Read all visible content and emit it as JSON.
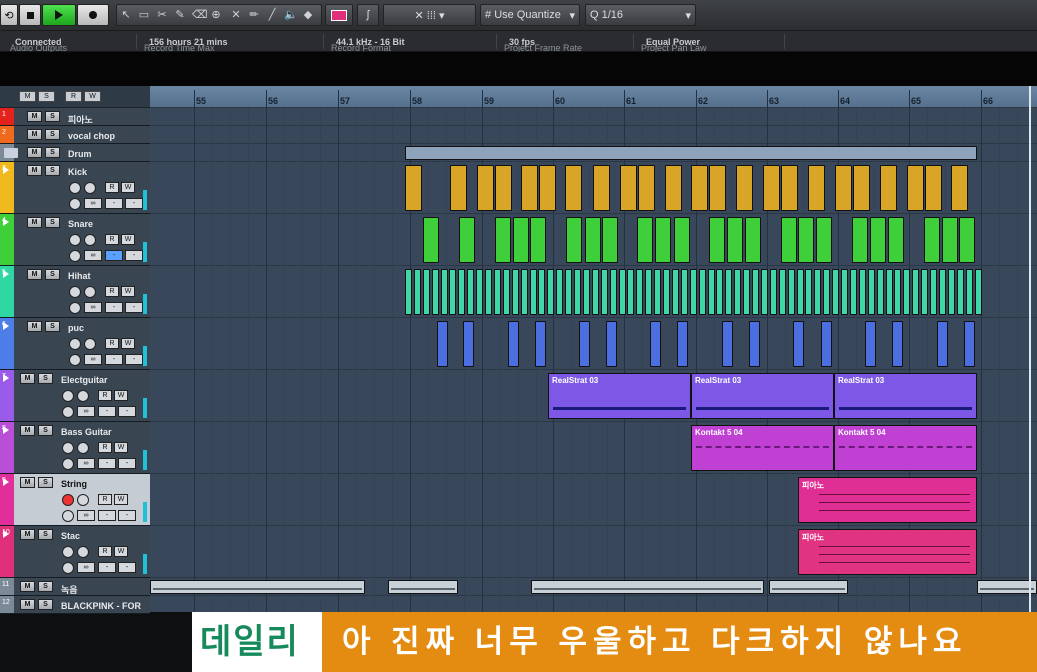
{
  "toolbar": {
    "quantize_label": "Use Quantize",
    "quantize_value": "1/16",
    "play_icon": "play-icon",
    "stop_icon": "stop-icon",
    "record_icon": "record-icon"
  },
  "info_line": [
    {
      "label": "Audio Outputs",
      "value": "Connected"
    },
    {
      "label": "Record Time Max",
      "value": "156 hours 21 mins"
    },
    {
      "label": "Record Format",
      "value": "44.1 kHz - 16 Bit"
    },
    {
      "label": "Project Frame Rate",
      "value": "30 fps"
    },
    {
      "label": "Project Pan Law",
      "value": "Equal Power"
    }
  ],
  "ruler": {
    "bars": [
      "55",
      "56",
      "57",
      "58",
      "59",
      "60",
      "61",
      "62",
      "63",
      "64",
      "65",
      "66"
    ]
  },
  "tracks": [
    {
      "num": "1",
      "name": "피아노",
      "color": "#e3221e"
    },
    {
      "num": "2",
      "name": "vocal chop",
      "color": "#ef6a1c"
    },
    {
      "num": "",
      "name": "Drum",
      "color": "#7c8a98"
    },
    {
      "num": "3",
      "name": "Kick",
      "color": "#f0ba1e"
    },
    {
      "num": "4",
      "name": "Snare",
      "color": "#3fcf38"
    },
    {
      "num": "5",
      "name": "Hihat",
      "color": "#2fd8a2"
    },
    {
      "num": "6",
      "name": "puc",
      "color": "#4d7ee8"
    },
    {
      "num": "7",
      "name": "Electguitar",
      "color": "#9a5ce8"
    },
    {
      "num": "8",
      "name": "Bass Guitar",
      "color": "#b84fd6"
    },
    {
      "num": "9",
      "name": "String",
      "color": "#e02e9a"
    },
    {
      "num": "10",
      "name": "Stac",
      "color": "#e0307a"
    },
    {
      "num": "11",
      "name": "녹음",
      "color": "#7c8a98"
    },
    {
      "num": "12",
      "name": "BLACKPINK - FOR",
      "color": "#7c8a98"
    }
  ],
  "events": {
    "electguitar": [
      "RealStrat 03",
      "RealStrat 03",
      "RealStrat 03"
    ],
    "bass": [
      "Kontakt 5 04",
      "Kontakt 5 04"
    ],
    "string": [
      "피아노"
    ],
    "stac": [
      "피아노"
    ]
  },
  "subtitle": {
    "left": "데일리",
    "right": "아 진짜 너무 우울하고 다크하지 않나요"
  },
  "colors": {
    "kick": "#d8a526",
    "snare": "#3ecf3a",
    "hihat": "#3fd7a7",
    "puc": "#4b6fe0",
    "guitar": "#7d58e6",
    "bass": "#c040d4",
    "string": "#e02f94",
    "stac": "#e03382"
  }
}
